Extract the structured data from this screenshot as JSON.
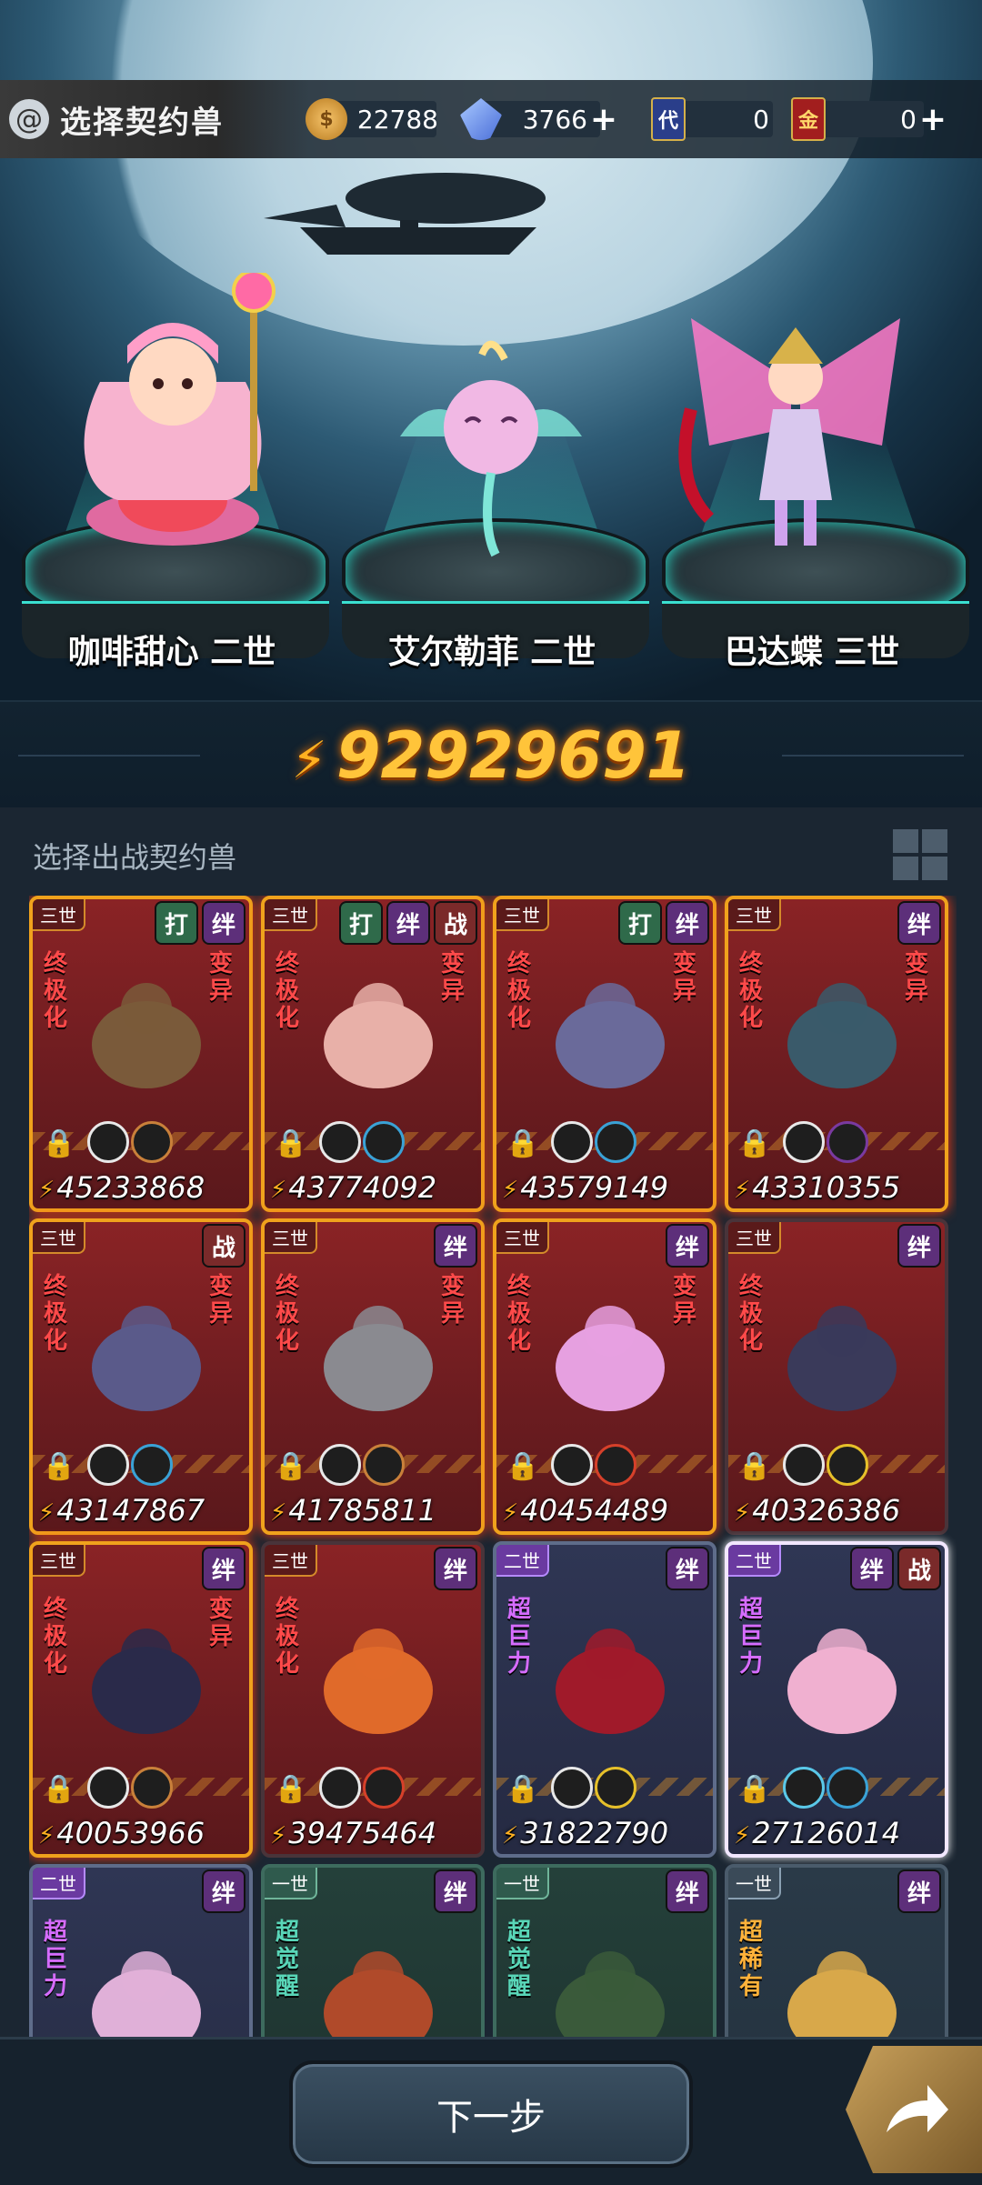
{
  "header": {
    "title": "选择契约兽",
    "resources": [
      {
        "icon": "gold-coin-icon",
        "value": "22788",
        "has_plus": false
      },
      {
        "icon": "crystal-icon",
        "value": "3766",
        "has_plus": true
      },
      {
        "icon": "substitute-ticket-icon",
        "label": "代",
        "value": "0",
        "has_plus": false
      },
      {
        "icon": "gold-ticket-icon",
        "label": "金",
        "value": "0",
        "has_plus": true
      }
    ]
  },
  "team": [
    {
      "name": "咖啡甜心 二世"
    },
    {
      "name": "艾尔勒菲 二世"
    },
    {
      "name": "巴达蝶 三世"
    }
  ],
  "total_power": "92929691",
  "section_label": "选择出战契约兽",
  "cards": [
    {
      "gen": "三世",
      "tags": [
        "打",
        "绊"
      ],
      "rank": "终极化",
      "mut": "变异",
      "power": "45233868",
      "style": "red"
    },
    {
      "gen": "三世",
      "tags": [
        "打",
        "绊",
        "战"
      ],
      "rank": "终极化",
      "mut": "变异",
      "power": "43774092",
      "style": "red"
    },
    {
      "gen": "三世",
      "tags": [
        "打",
        "绊"
      ],
      "rank": "终极化",
      "mut": "变异",
      "power": "43579149",
      "style": "red"
    },
    {
      "gen": "三世",
      "tags": [
        "绊"
      ],
      "rank": "终极化",
      "mut": "变异",
      "power": "43310355",
      "style": "red"
    },
    {
      "gen": "三世",
      "tags": [
        "战"
      ],
      "rank": "终极化",
      "mut": "变异",
      "power": "43147867",
      "style": "red"
    },
    {
      "gen": "三世",
      "tags": [
        "绊"
      ],
      "rank": "终极化",
      "mut": "变异",
      "power": "41785811",
      "style": "red"
    },
    {
      "gen": "三世",
      "tags": [
        "绊"
      ],
      "rank": "终极化",
      "mut": "变异",
      "power": "40454489",
      "style": "red"
    },
    {
      "gen": "三世",
      "tags": [
        "绊"
      ],
      "rank": "终极化",
      "mut": "",
      "power": "40326386",
      "style": "red2"
    },
    {
      "gen": "三世",
      "tags": [
        "绊"
      ],
      "rank": "终极化",
      "mut": "变异",
      "power": "40053966",
      "style": "red"
    },
    {
      "gen": "三世",
      "tags": [
        "绊"
      ],
      "rank": "终极化",
      "mut": "",
      "power": "39475464",
      "style": "red2"
    },
    {
      "gen": "二世",
      "tags": [
        "绊"
      ],
      "rank": "超巨力",
      "mut": "",
      "power": "31822790",
      "style": "purple"
    },
    {
      "gen": "二世",
      "tags": [
        "绊",
        "战"
      ],
      "rank": "超巨力",
      "mut": "",
      "power": "27126014",
      "style": "purple sel"
    },
    {
      "gen": "二世",
      "tags": [
        "绊"
      ],
      "rank": "超巨力",
      "mut": "",
      "power": "",
      "style": "purple"
    },
    {
      "gen": "一世",
      "tags": [
        "绊"
      ],
      "rank": "超觉醒",
      "mut": "",
      "power": "",
      "style": "green"
    },
    {
      "gen": "一世",
      "tags": [
        "绊"
      ],
      "rank": "超觉醒",
      "mut": "",
      "power": "",
      "style": "green"
    },
    {
      "gen": "一世",
      "tags": [
        "绊"
      ],
      "rank": "超稀有",
      "mut": "",
      "power": "",
      "style": "grey"
    }
  ],
  "footer": {
    "next_label": "下一步"
  }
}
